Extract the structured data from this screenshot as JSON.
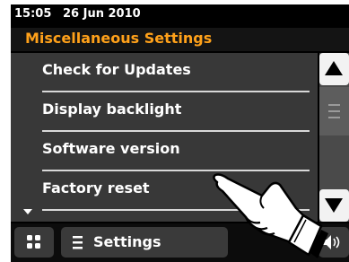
{
  "status": {
    "time": "15:05",
    "date": "26 Jun 2010"
  },
  "header": {
    "title": "Miscellaneous Settings"
  },
  "menu": {
    "items": [
      {
        "label": "Check for Updates"
      },
      {
        "label": "Display backlight"
      },
      {
        "label": "Software version"
      },
      {
        "label": "Factory reset"
      }
    ]
  },
  "scrollbar": {
    "up_icon": "up-triangle-icon",
    "down_icon": "down-triangle-icon"
  },
  "bottombar": {
    "home_icon": "grid-icon",
    "settings_label": "Settings",
    "settings_icon": "menu-lines-icon",
    "volume_icon": "speaker-icon"
  },
  "colors": {
    "accent": "#ffa11a",
    "list_bg": "#383838",
    "screen_bg": "#000000"
  }
}
